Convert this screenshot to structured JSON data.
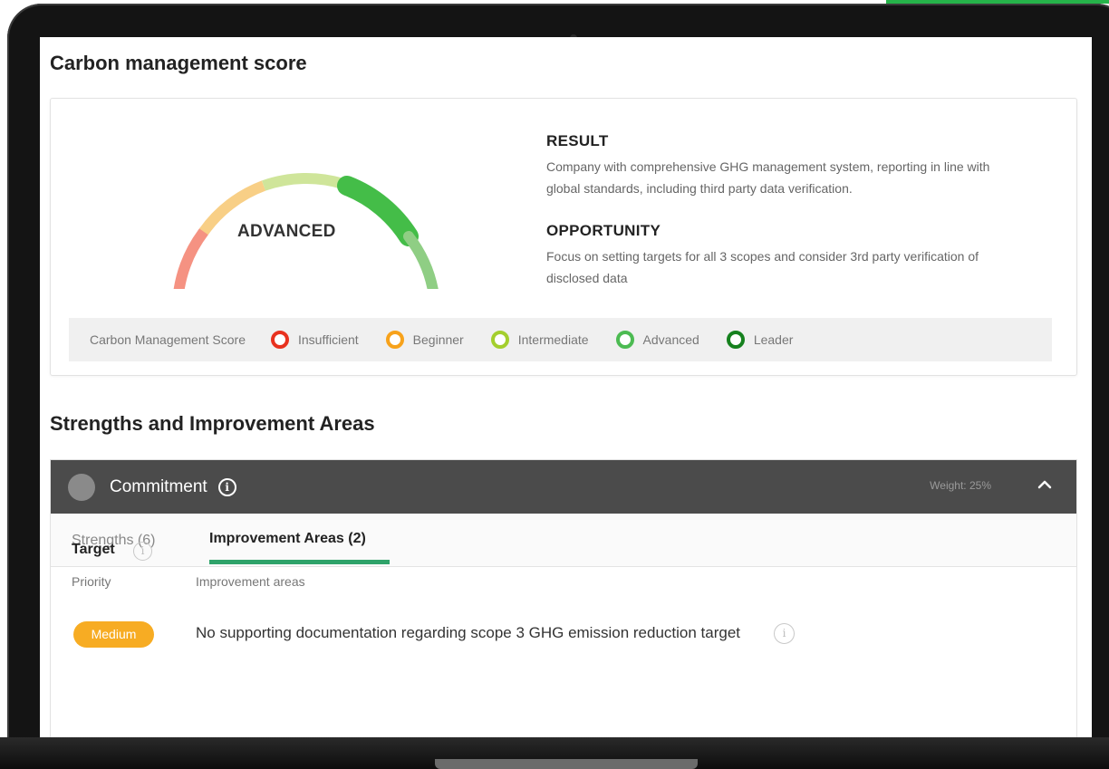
{
  "page": {
    "title": "Carbon management score"
  },
  "gauge": {
    "level": "ADVANCED"
  },
  "result": {
    "title": "RESULT",
    "text": "Company with comprehensive GHG management system, reporting in line with global standards, including third party data verification."
  },
  "opportunity": {
    "title": "OPPORTUNITY",
    "text": "Focus on setting targets for all 3 scopes and consider 3rd party verification of disclosed data"
  },
  "legend": {
    "title": "Carbon Management Score",
    "items": [
      {
        "label": "Insufficient",
        "color": "#e8321f"
      },
      {
        "label": "Beginner",
        "color": "#f7a21b"
      },
      {
        "label": "Intermediate",
        "color": "#a4cf2e"
      },
      {
        "label": "Advanced",
        "color": "#4cbb52"
      },
      {
        "label": "Leader",
        "color": "#16811e"
      }
    ]
  },
  "strengths_section": {
    "title": "Strengths and Improvement Areas",
    "category": "Commitment",
    "weight": "Weight: 25%",
    "tabs": [
      {
        "label": "Strengths (6)",
        "active": false
      },
      {
        "label": "Improvement Areas (2)",
        "active": true
      }
    ],
    "target_title": "Target",
    "columns": [
      "Priority",
      "Improvement areas"
    ],
    "rows": [
      {
        "priority": "Medium",
        "priority_color": "#f7ac23",
        "text": "No supporting documentation regarding scope 3 GHG emission reduction target"
      }
    ]
  },
  "icons": {
    "info": "info-icon",
    "collapse": "chevron-up-icon"
  }
}
